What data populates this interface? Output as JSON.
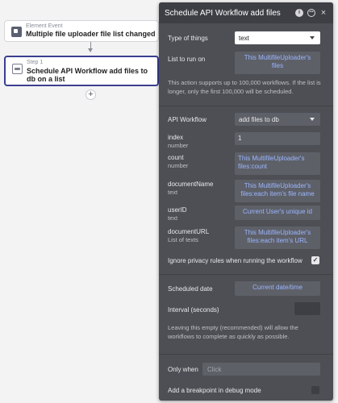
{
  "canvas": {
    "event": {
      "kind": "Element Event",
      "title": "Multiple file uploader file list changed"
    },
    "step": {
      "kind": "Step 1",
      "title": "Schedule API Workflow add files to db on a list"
    },
    "add_symbol": "+"
  },
  "panel": {
    "title": "Schedule API Workflow add files",
    "header_icons": [
      "info-icon",
      "comment-icon",
      "close-icon"
    ],
    "type_of_things": {
      "label": "Type of things",
      "value": "text"
    },
    "list_to_run_on": {
      "label": "List to run on",
      "value": "This MultifileUploader's files"
    },
    "limit_note": "This action supports up to 100,000 workflows. If the list is longer, only the first 100,000 will be scheduled.",
    "api_workflow": {
      "label": "API Workflow",
      "value": "add files to db"
    },
    "params": [
      {
        "name": "index",
        "type": "number",
        "value": "1"
      },
      {
        "name": "count",
        "type": "number",
        "value": "This MultifileUploader's files:count"
      },
      {
        "name": "documentName",
        "type": "text",
        "value": "This MultifileUploader's files:each item's file name"
      },
      {
        "name": "userID",
        "type": "text",
        "value": "Current User's unique id"
      },
      {
        "name": "documentURL",
        "type": "List of texts",
        "value": "This MultifileUploader's files:each item's URL"
      }
    ],
    "ignore_privacy": {
      "label": "Ignore privacy rules when running the workflow",
      "checked": true,
      "mark": "✓"
    },
    "scheduled_date": {
      "label": "Scheduled date",
      "value": "Current date/time"
    },
    "interval": {
      "label": "Interval (seconds)",
      "value": ""
    },
    "interval_note": "Leaving this empty (recommended) will allow the workflows to complete as quickly as possible.",
    "only_when": {
      "label": "Only when",
      "placeholder": "Click"
    },
    "breakpoint": {
      "label": "Add a breakpoint in debug mode",
      "checked": false
    }
  },
  "colors": {
    "panel_bg": "#4d4f55",
    "header_bg": "#3d3f44",
    "dynamic_text": "#9ab6ff",
    "selected_border": "#3a3f8f"
  }
}
